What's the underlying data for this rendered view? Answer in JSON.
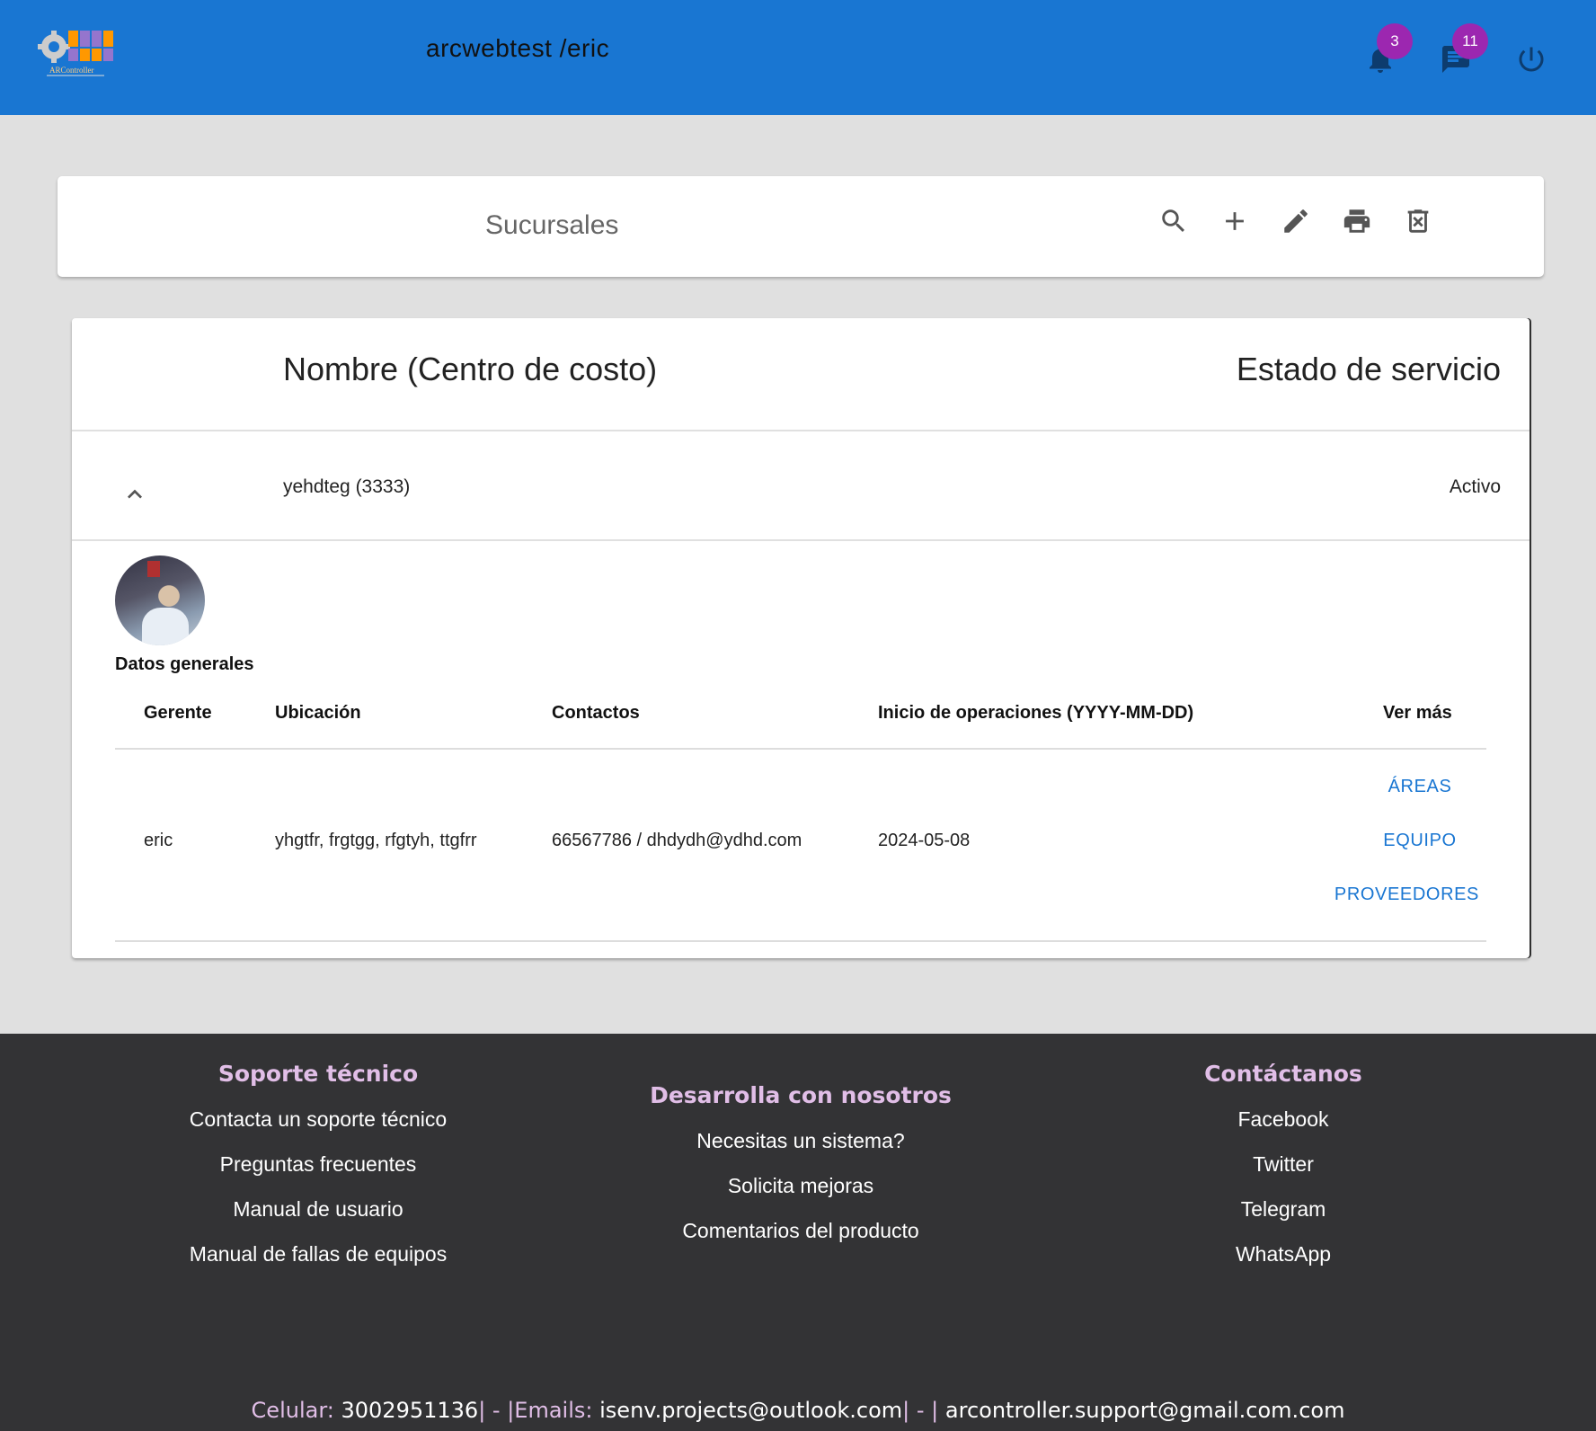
{
  "header": {
    "logo_text": "ARController",
    "title": "arcwebtest /eric",
    "notifications_count": "3",
    "messages_count": "11"
  },
  "toolbar": {
    "title": "Sucursales",
    "actions": [
      "search-icon",
      "add-icon",
      "edit-icon",
      "print-icon",
      "delete-icon"
    ]
  },
  "table": {
    "headers": {
      "name": "Nombre (Centro de costo)",
      "status": "Estado de servicio"
    },
    "row": {
      "name": "yehdteg (3333)",
      "status": "Activo"
    },
    "details": {
      "section_title": "Datos generales",
      "headers": [
        "Gerente",
        "Ubicación",
        "Contactos",
        "Inicio de operaciones (YYYY-MM-DD)",
        "Ver más"
      ],
      "values": {
        "manager": "eric",
        "location": "yhgtfr, frgtgg, rfgtyh, ttgfrr",
        "contacts": "66567786 / dhdydh@ydhd.com",
        "start_date": "2024-05-08"
      },
      "links": [
        "ÁREAS",
        "EQUIPO",
        "PROVEEDORES"
      ]
    }
  },
  "footer": {
    "columns": [
      {
        "title": "Soporte técnico",
        "links": [
          "Contacta un soporte técnico",
          "Preguntas frecuentes",
          "Manual de usuario",
          "Manual de fallas de equipos"
        ]
      },
      {
        "title": "Desarrolla con nosotros",
        "links": [
          "Necesitas un sistema?",
          "Solicita mejoras",
          "Comentarios del producto"
        ]
      },
      {
        "title": "Contáctanos",
        "links": [
          "Facebook",
          "Twitter",
          "Telegram",
          "WhatsApp"
        ]
      }
    ],
    "contact": {
      "phone_label": "Celular:",
      "phone": "3002951136",
      "sep1": "| - |",
      "emails_label": "Emails:",
      "email1": "isenv.projects@outlook.com",
      "sep2": "| - |",
      "email2": "arcontroller.support@gmail.com.com"
    }
  },
  "colors": {
    "primary": "#1976d2",
    "badge": "#9c27b0",
    "footer_bg": "#333335",
    "footer_heading": "#e1bee7"
  }
}
